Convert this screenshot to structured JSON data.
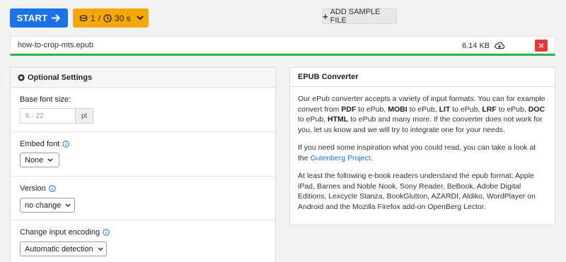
{
  "toolbar": {
    "start_label": "START",
    "conversions_count": "1",
    "conversions_sep": "/",
    "time_label": "30 s",
    "add_sample_label": "ADD SAMPLE FILE"
  },
  "file": {
    "name": "how-to-crop-mts.epub",
    "size": "6.14 KB",
    "progress": 1.0
  },
  "settings": {
    "title": "Optional Settings",
    "base_font": {
      "label": "Base font size:",
      "placeholder": "6 - 22",
      "unit": "pt"
    },
    "embed_font": {
      "label": "Embed font",
      "value": "None"
    },
    "version": {
      "label": "Version",
      "value": "no change"
    },
    "encoding": {
      "label": "Change input encoding",
      "value": "Automatic detection"
    }
  },
  "converter": {
    "title": "EPUB Converter",
    "p1": {
      "t1": "Our ePub converter accepts a variety of input formats. You can for example convert from ",
      "f1": "PDF",
      "t2": " to ePub, ",
      "f2": "MOBI",
      "t3": " to ePub, ",
      "f3": "LIT",
      "t4": " to ePub, ",
      "f4": "LRF",
      "t5": " to ePub, ",
      "f5": "DOC",
      "t6": " to ePub, ",
      "f6": "HTML",
      "t7": " to ePub and many more. If the converter does not work for you, let us know and we will try to integrate one for your needs."
    },
    "p2": {
      "text": "If you need some inspiration what you could read, you can take a look at the ",
      "link": "Gutenberg Project",
      "end": "."
    },
    "p3": "At least the following e-book readers understand the epub format: Apple iPad, Barnes and Noble Nook, Sony Reader, BeBook, Adobe Digital Editions, Lexcycle Stanza, BookGlutton, AZARDI, Aldiko, WordPlayer on Android and the Mozilla Firefox add-on OpenBerg Lector."
  },
  "colors": {
    "start": "#1a73e8",
    "conversions": "#f5a800",
    "progress": "#2bb34a",
    "remove": "#e53935",
    "link": "#1a73e8"
  },
  "icons": [
    "arrow-right-icon",
    "coins-icon",
    "clock-icon",
    "chevron-down-icon",
    "plus-icon",
    "cloud-download-icon",
    "close-icon",
    "gear-icon",
    "info-icon",
    "select-arrow-icon"
  ]
}
